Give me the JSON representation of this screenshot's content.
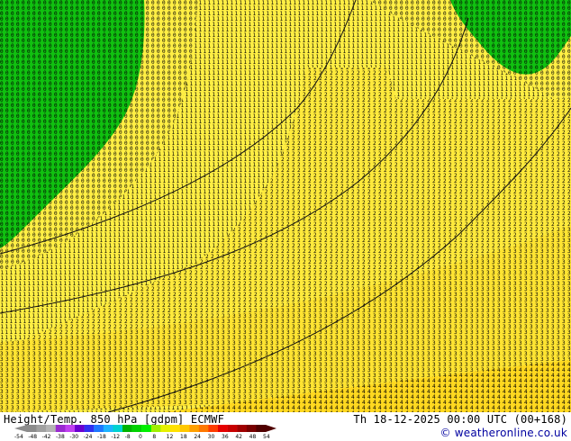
{
  "map": {
    "regions": {
      "warm_fill": "#ffe84a",
      "cool_fill": "#ffd21e",
      "green_fill": "#10c010",
      "glyph_color": "#000000",
      "contour_color": "#111111"
    }
  },
  "footer": {
    "title": "Height/Temp. 850 hPa [gdpm] ECMWF",
    "valid_time": "Th 18-12-2025 00:00 UTC (00+168)",
    "credit": "© weatheronline.co.uk"
  },
  "legend": {
    "colors": [
      "#8c8c8c",
      "#a0a0a0",
      "#b4b4b4",
      "#9a2ad0",
      "#c040f0",
      "#6a00d0",
      "#3030f0",
      "#1e78ff",
      "#1eb4ff",
      "#00d2d2",
      "#00b400",
      "#00d200",
      "#00f000",
      "#a0f000",
      "#e6f000",
      "#ffe100",
      "#ffc800",
      "#ffa000",
      "#ff7800",
      "#ff3c00",
      "#e60000",
      "#c80000",
      "#a00000",
      "#780000",
      "#500000"
    ],
    "labels": [
      "-54",
      "-48",
      "-42",
      "-38",
      "-30",
      "-24",
      "-18",
      "-12",
      "-8",
      "0",
      "8",
      "12",
      "18",
      "24",
      "30",
      "36",
      "42",
      "48",
      "54"
    ]
  }
}
